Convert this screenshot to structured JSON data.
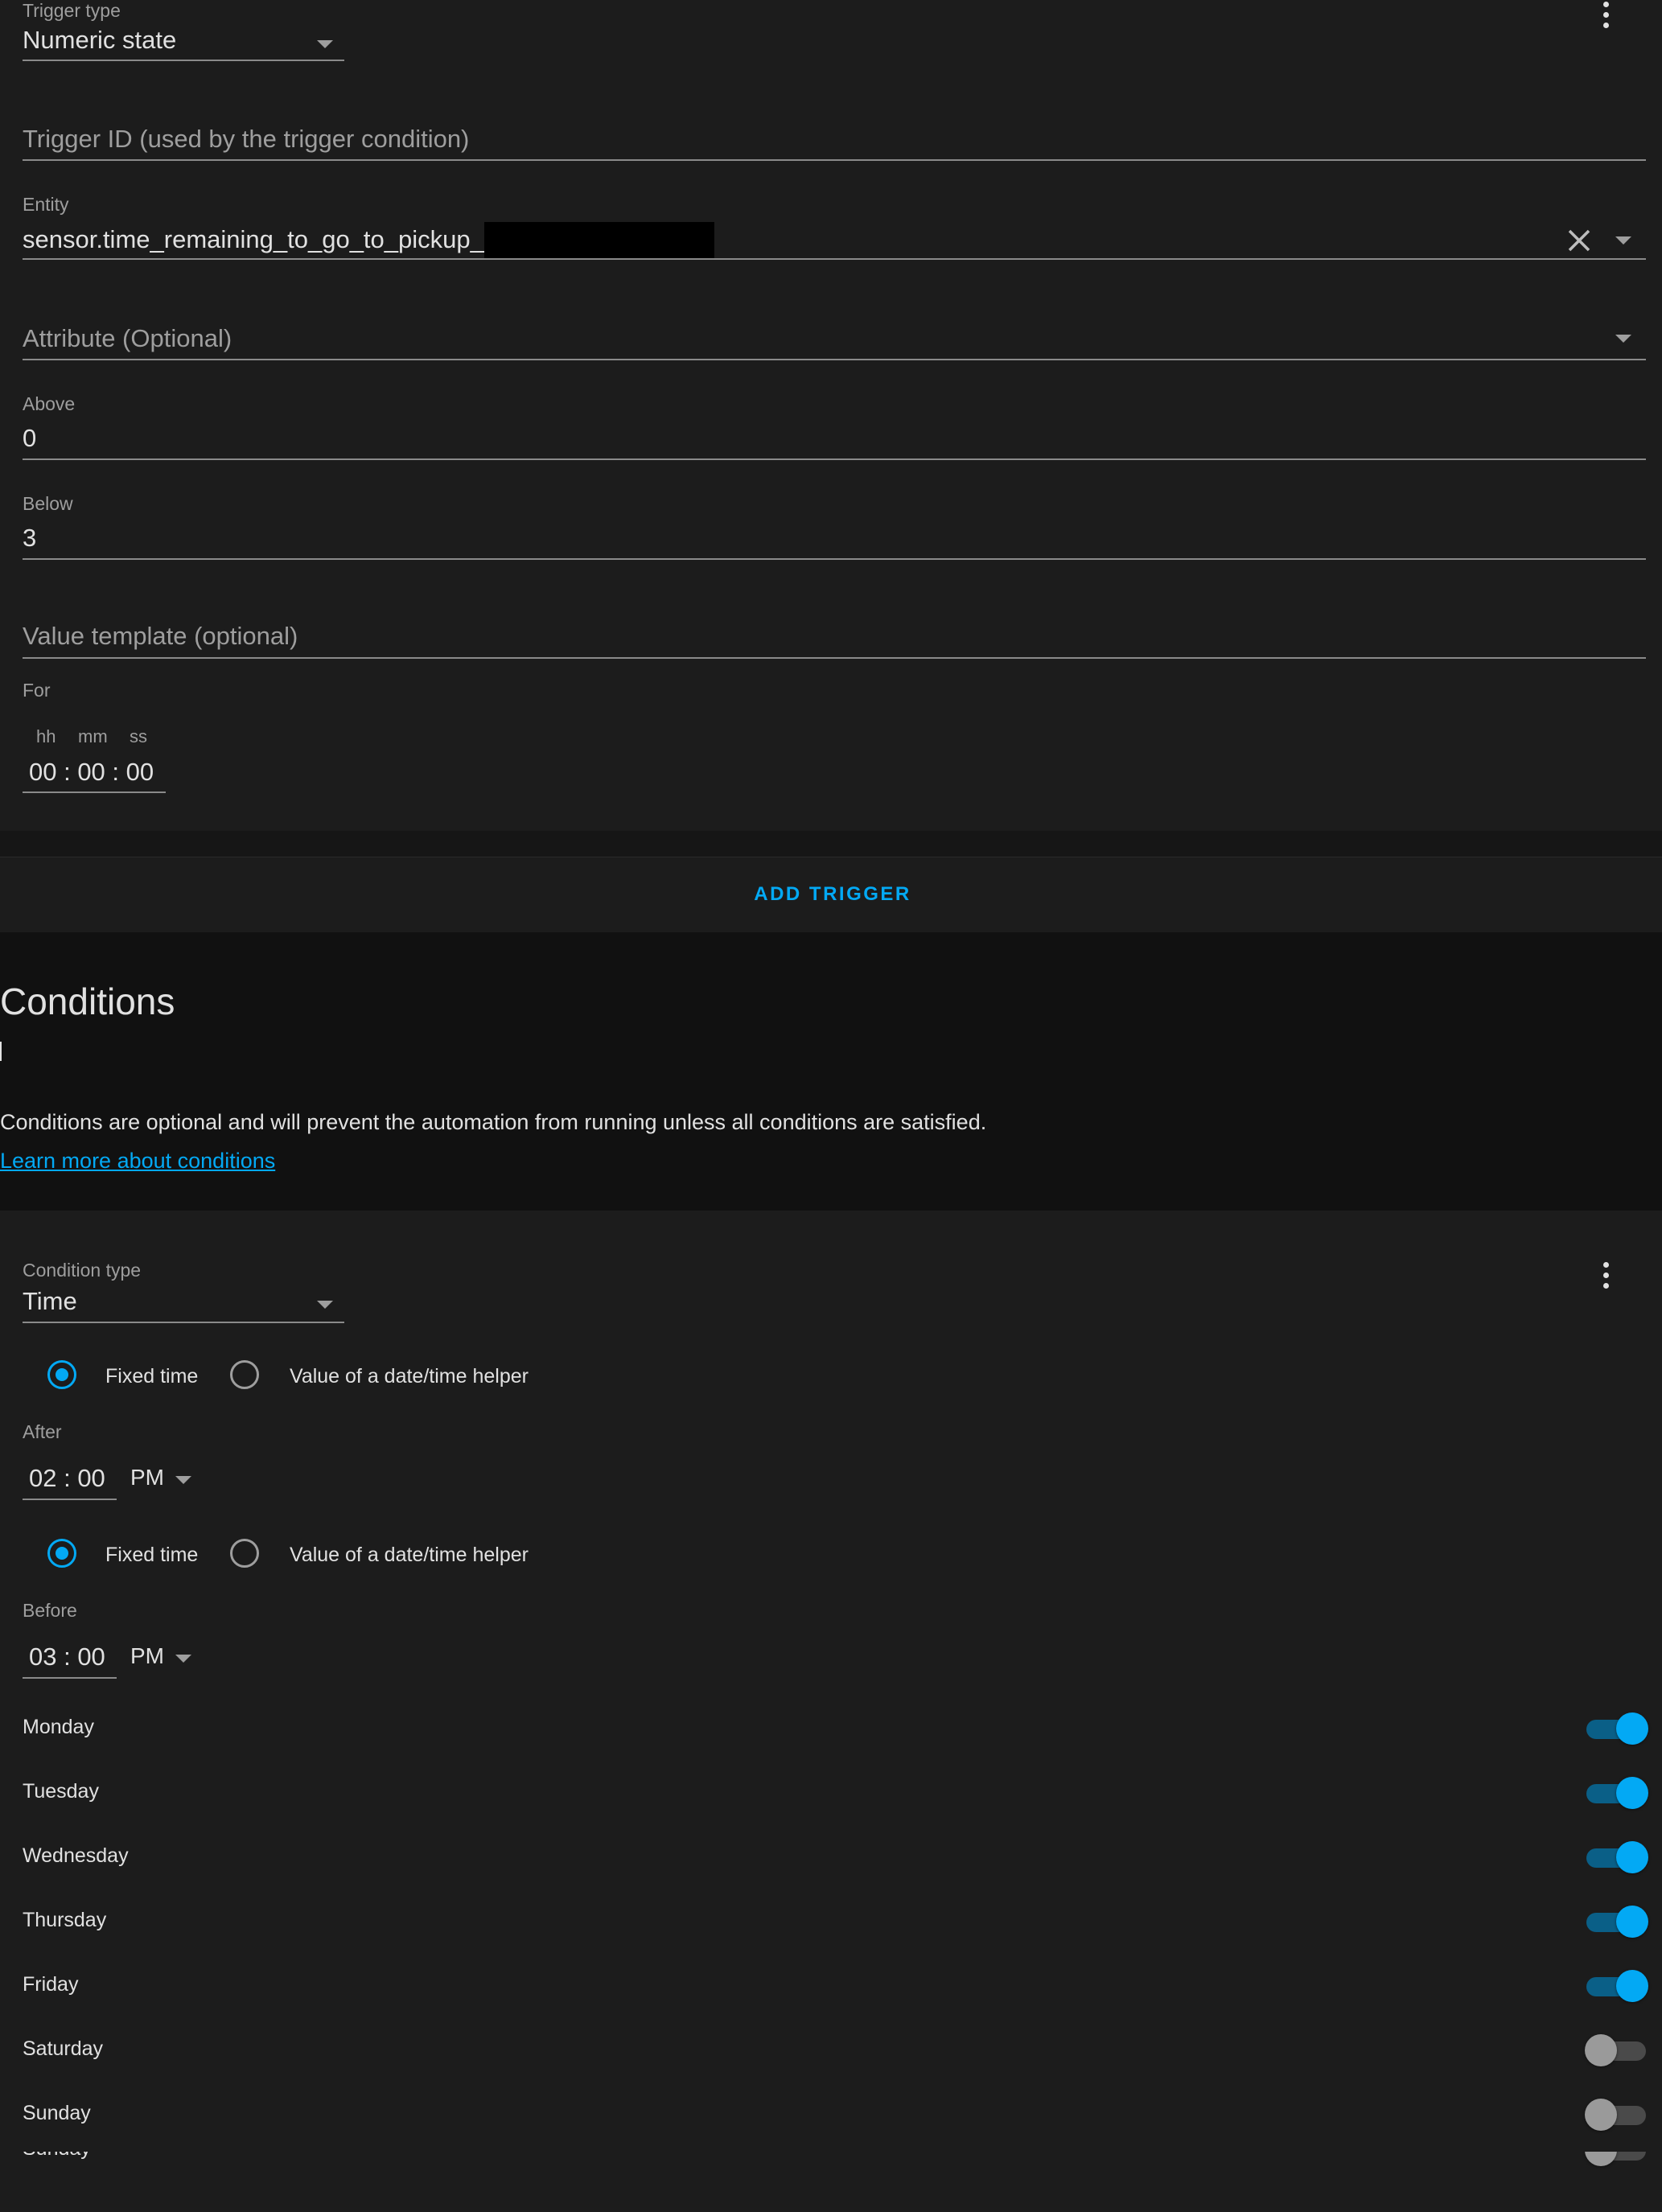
{
  "trigger": {
    "type_label": "Trigger type",
    "type_value": "Numeric state",
    "id_placeholder": "Trigger ID (used by the trigger condition)",
    "entity_label": "Entity",
    "entity_value": "sensor.time_remaining_to_go_to_pickup_",
    "attribute_placeholder": "Attribute (Optional)",
    "above_label": "Above",
    "above_value": "0",
    "below_label": "Below",
    "below_value": "3",
    "value_template_placeholder": "Value template (optional)",
    "for_label": "For",
    "for_units": {
      "hh": "hh",
      "mm": "mm",
      "ss": "ss"
    },
    "for_value": "00 : 00 : 00"
  },
  "add_trigger_label": "ADD TRIGGER",
  "conditions": {
    "title": "Conditions",
    "description": "Conditions are optional and will prevent the automation from running unless all conditions are satisfied.",
    "learn_more": "Learn more about conditions"
  },
  "condition": {
    "type_label": "Condition type",
    "type_value": "Time",
    "radio_fixed": "Fixed time",
    "radio_helper": "Value of a date/time helper",
    "after_label": "After",
    "after_time": "02 : 00",
    "after_ampm": "PM",
    "before_label": "Before",
    "before_time": "03 : 00",
    "before_ampm": "PM",
    "days": [
      {
        "name": "Monday",
        "on": true
      },
      {
        "name": "Tuesday",
        "on": true
      },
      {
        "name": "Wednesday",
        "on": true
      },
      {
        "name": "Thursday",
        "on": true
      },
      {
        "name": "Friday",
        "on": true
      },
      {
        "name": "Saturday",
        "on": false
      },
      {
        "name": "Sunday",
        "on": false
      }
    ],
    "clipped_day": "Sunday"
  },
  "colors": {
    "accent": "#03a9f4",
    "background": "#111111",
    "card": "#1c1c1c"
  },
  "icons": [
    "dots-vertical-icon",
    "menu-down-icon",
    "close-icon"
  ]
}
